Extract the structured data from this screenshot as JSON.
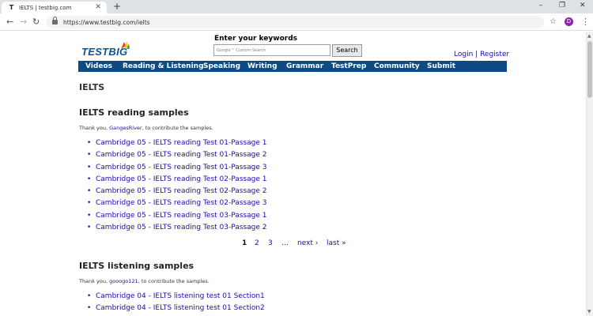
{
  "browser": {
    "tab_title": "IELTS | testbig.com",
    "tab_favicon": "T",
    "url": "https://www.testbig.com/ielts",
    "avatar_letter": "D"
  },
  "header": {
    "logo_text": "TESTBIG",
    "search_label": "Enter your keywords",
    "search_placeholder": "Google™ Custom Search",
    "search_button": "Search",
    "login": "Login",
    "separator": "|",
    "register": "Register"
  },
  "navbar": {
    "items": [
      "Videos",
      "Reading & Listening",
      "Speaking",
      "Writing",
      "Grammar",
      "TestPrep",
      "Community",
      "Submit"
    ]
  },
  "page_title": "IELTS",
  "reading": {
    "title": "IELTS reading samples",
    "thanks_prefix": "Thank you, ",
    "contributor": "GangesRiver",
    "thanks_suffix": ", to contribute the samples.",
    "links": [
      "Cambridge 05 - IELTS reading Test 01-Passage 1",
      "Cambridge 05 - IELTS reading Test 01-Passage 2",
      "Cambridge 05 - IELTS reading Test 01-Passage 3",
      "Cambridge 05 - IELTS reading Test 02-Passage 1",
      "Cambridge 05 - IELTS reading Test 02-Passage 2",
      "Cambridge 05 - IELTS reading Test 02-Passage 3",
      "Cambridge 05 - IELTS reading Test 03-Passage 1",
      "Cambridge 05 - IELTS reading Test 03-Passage 2"
    ]
  },
  "pager": {
    "current": "1",
    "page2": "2",
    "page3": "3",
    "ellipsis": "…",
    "next": "next ›",
    "last": "last »"
  },
  "listening": {
    "title": "IELTS listening samples",
    "thanks_prefix": "Thank you, ",
    "contributor": "gooogo121",
    "thanks_suffix": ", to contribute the samples.",
    "links": [
      "Cambridge 04 - IELTS listening test 01 Section1",
      "Cambridge 04 - IELTS listening test 01 Section2"
    ]
  },
  "colors": {
    "navbar": "#0c4b84",
    "link": "#1a0dab"
  }
}
